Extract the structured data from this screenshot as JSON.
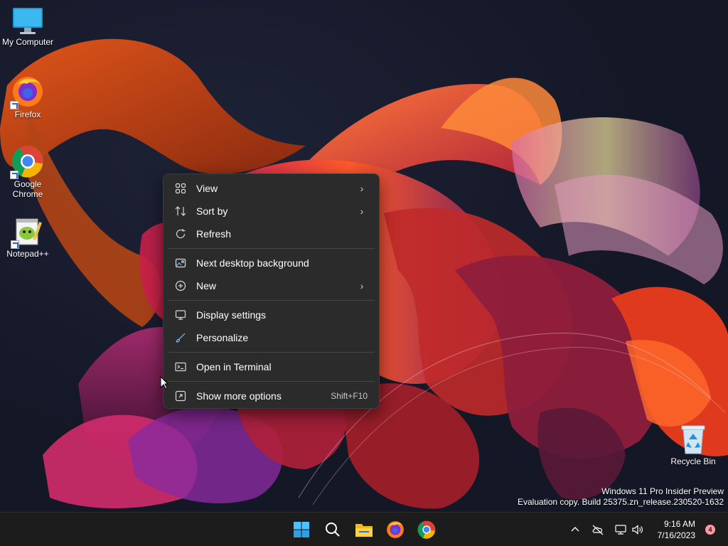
{
  "desktop": {
    "icons": [
      {
        "label": "My Computer",
        "icon": "monitor-icon"
      },
      {
        "label": "Firefox",
        "icon": "firefox-icon"
      },
      {
        "label": "Google Chrome",
        "icon": "chrome-icon"
      },
      {
        "label": "Notepad++",
        "icon": "notepadpp-icon"
      },
      {
        "label": "Recycle Bin",
        "icon": "recycle-bin-icon"
      }
    ]
  },
  "context_menu": {
    "items": [
      {
        "label": "View",
        "icon": "view-grid-icon",
        "submenu": true
      },
      {
        "label": "Sort by",
        "icon": "sort-icon",
        "submenu": true
      },
      {
        "label": "Refresh",
        "icon": "refresh-icon",
        "submenu": false
      },
      {
        "label": "Next desktop background",
        "icon": "next-background-icon",
        "submenu": false
      },
      {
        "label": "New",
        "icon": "new-plus-icon",
        "submenu": true
      },
      {
        "label": "Display settings",
        "icon": "display-icon",
        "submenu": false
      },
      {
        "label": "Personalize",
        "icon": "brush-icon",
        "submenu": false
      },
      {
        "label": "Open in Terminal",
        "icon": "terminal-icon",
        "submenu": false
      },
      {
        "label": "Show more options",
        "icon": "more-options-icon",
        "shortcut": "Shift+F10"
      }
    ]
  },
  "watermark": {
    "line1": "Windows 11 Pro Insider Preview",
    "line2": "Evaluation copy. Build 25375.zn_release.230520-1632"
  },
  "taskbar": {
    "pinned": [
      "start-icon",
      "search-icon",
      "file-explorer-icon",
      "firefox-icon",
      "chrome-icon"
    ],
    "tray_icons": [
      "chevron-up-icon",
      "cloud-offline-icon",
      "network-icon",
      "volume-icon"
    ],
    "time": "9:16 AM",
    "date": "7/16/2023",
    "notification_count": "4"
  },
  "colors": {
    "menu_bg": "#2b2b2b",
    "taskbar_bg": "#1c1c1c",
    "accent": "#0078d4",
    "badge": "#ff99a4"
  }
}
